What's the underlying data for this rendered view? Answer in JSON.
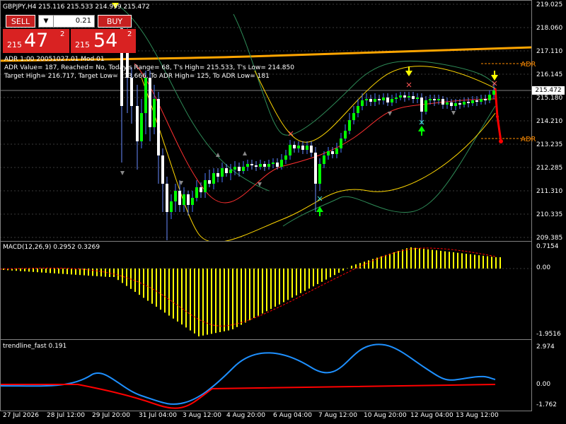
{
  "symbol_line": "GBPJPY,H4  215.116 215.533 214.999 215.472",
  "trade_panel": {
    "sell_label": "SELL",
    "buy_label": "BUY",
    "lots": "0.21",
    "sell_price_small": "215",
    "sell_price_big": "47",
    "sell_price_sup": "2",
    "buy_price_small": "215",
    "buy_price_big": "54",
    "buy_price_sup": "2"
  },
  "info_lines": [
    "ADR 1:00 20051027.01 Mod 01",
    "ADR Value= 187, Reached= No, Today's Range= 68, T's High= 215.533, T's Low= 214.850",
    "Target High= 216.717, Target Low= 213.666, To ADR High= 125, To ADR Low= 181"
  ],
  "price_axis": [
    "219.025",
    "218.060",
    "217.110",
    "216.145",
    "215.180",
    "214.210",
    "213.235",
    "212.285",
    "211.310",
    "210.335",
    "209.385"
  ],
  "current_price": "215.472",
  "adr_label": "ADR",
  "macd": {
    "label": "MACD(12,26,9) 0.2952 0.3269",
    "axis": [
      "0.7154",
      "0.00",
      "-1.9516"
    ]
  },
  "trendline": {
    "label": "trendline_fast 0.191",
    "axis": [
      "2.974",
      "0.00",
      "-1.762"
    ]
  },
  "dates": [
    "27 Jul 2026",
    "28 Jul 12:00",
    "29 Jul 20:00",
    "31 Jul 04:00",
    "3 Aug 12:00",
    "4 Aug 20:00",
    "6 Aug 04:00",
    "7 Aug 12:00",
    "10 Aug 20:00",
    "12 Aug 04:00",
    "13 Aug 12:00"
  ],
  "colors": {
    "bull": "#00ff00",
    "bear": "#ffffff",
    "orange": "#ffa500",
    "macd_hist": "#ffff00",
    "signal": "#ff0000",
    "blue": "#1e90ff"
  },
  "icons": {
    "down_arrow": "down-arrow-icon",
    "up_arrow": "up-arrow-icon"
  }
}
